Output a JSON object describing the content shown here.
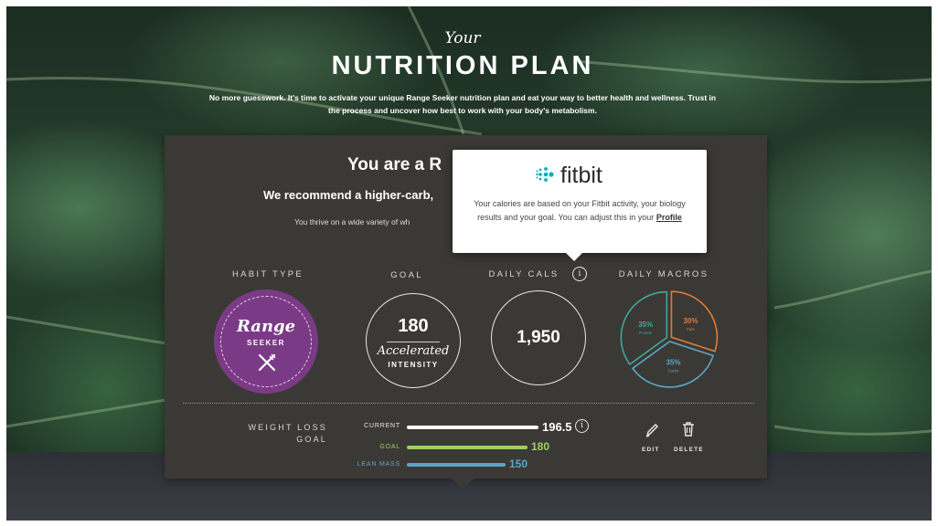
{
  "hero": {
    "script": "Your",
    "title": "NUTRITION PLAN",
    "subtitle": "No more guesswork. It's time to activate your unique Range Seeker nutrition plan and eat your way to better health and wellness. Trust in the process and uncover how best to work with your body's metabolism."
  },
  "card": {
    "title": "You are a R",
    "recommendation": "We recommend a higher-carb,",
    "thrive": "You thrive on a wide variety of wh"
  },
  "metrics": {
    "habit_label": "HABIT TYPE",
    "goal_label": "GOAL",
    "cals_label": "DAILY CALS",
    "macros_label": "DAILY MACROS",
    "habit_script": "Range",
    "habit_sub": "SEEKER",
    "goal_value": "180",
    "goal_script": "Accelerated",
    "goal_intensity": "INTENSITY",
    "cals_value": "1,950",
    "info_glyph": "i"
  },
  "macros": [
    {
      "percent": "35%",
      "name": "Protein",
      "value": 35,
      "color": "#3fa89b"
    },
    {
      "percent": "30%",
      "name": "Fats",
      "value": 30,
      "color": "#e07a33"
    },
    {
      "percent": "35%",
      "name": "Carbs",
      "value": 35,
      "color": "#5aa6c8"
    }
  ],
  "weight_loss": {
    "label_line1": "WEIGHT LOSS",
    "label_line2": "GOAL",
    "bars": [
      {
        "label": "CURRENT",
        "value": "196.5",
        "color": "#ffffff"
      },
      {
        "label": "GOAL",
        "value": "180",
        "color": "#9ccf63"
      },
      {
        "label": "LEAN MASS",
        "value": "150",
        "color": "#5aa6c8"
      }
    ]
  },
  "actions": {
    "edit": "EDIT",
    "delete": "DELETE"
  },
  "tooltip": {
    "brand": "fitbit",
    "text_before": "Your calories are based on your Fitbit activity, your biology results and your goal. You can adjust this in your",
    "link": "Profile"
  },
  "colors": {
    "card": "#3b3935",
    "habit_purple": "#7b3a86",
    "fitbit_teal": "#00b0b9"
  }
}
